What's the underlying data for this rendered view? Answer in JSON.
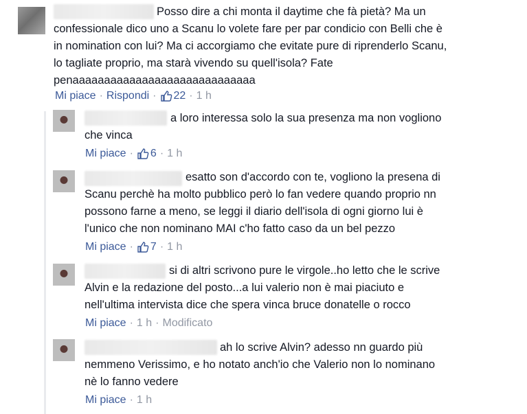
{
  "comments": [
    {
      "text": "Posso dire a chi monta il daytime che fà pietà? Ma un\nconfessionale dico uno a Scanu lo volete fare per par condicio con Belli che è\nin nomination con lui? Ma ci accorgiamo che evitate pure di riprenderlo Scanu,\nlo tagliate proprio, ma starà vivendo su quell'isola? Fate\npenaaaaaaaaaaaaaaaaaaaaaaaaaaaaa",
      "like_label": "Mi piace",
      "reply_label": "Rispondi",
      "likes": "22",
      "time": "1 h"
    }
  ],
  "replies": [
    {
      "text": "a loro interessa solo la sua presenza ma non vogliono\nche vinca",
      "like_label": "Mi piace",
      "likes": "6",
      "time": "1 h"
    },
    {
      "text": "esatto son d'accordo con te, vogliono la presena di\nScanu perchè ha molto pubblico però lo fan vedere quando proprio nn\npossono farne a meno, se leggi il diario dell'isola di ogni giorno lui è\nl'unico che non nominano MAI c'ho fatto caso da un bel pezzo",
      "like_label": "Mi piace",
      "likes": "7",
      "time": "1 h"
    },
    {
      "text": "si di altri scrivono pure le virgole..ho letto che le scrive\nAlvin e la redazione del posto...a lui valerio non è mai piaciuto e\nnell'ultima intervista dice che spera vinca bruce donatelle o rocco",
      "like_label": "Mi piace",
      "time": "1 h",
      "edited": "Modificato"
    },
    {
      "text": "ah lo scrive Alvin? adesso nn guardo più\nnemmeno Verissimo, e ho notato anch'io che Valerio non lo nominano\nnè lo fanno vedere",
      "like_label": "Mi piace",
      "time": "1 h"
    }
  ],
  "colors": {
    "link": "#3b5998",
    "meta": "#9197a3",
    "text": "#141823"
  }
}
